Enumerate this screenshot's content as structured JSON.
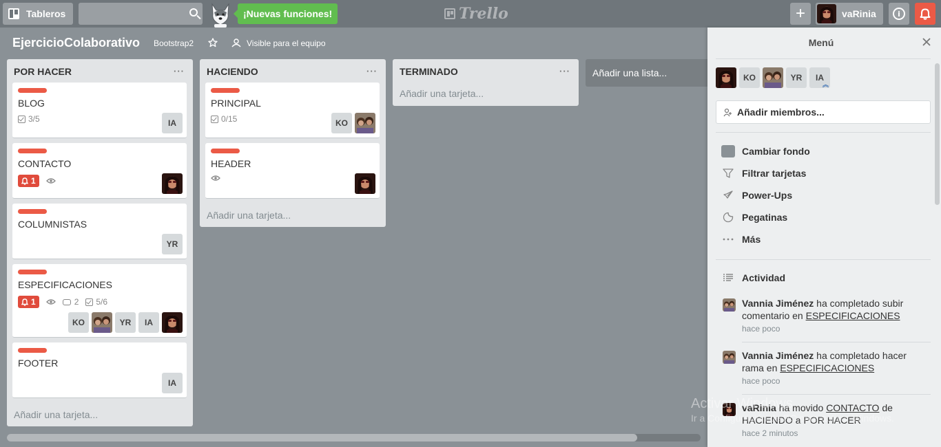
{
  "header": {
    "boards_label": "Tableros",
    "search_placeholder": "",
    "new_features": "¡Nuevas funciones!",
    "logo_text": "Trello",
    "add_label": "+",
    "user_name": "vaRinia"
  },
  "board": {
    "title": "EjercicioColaborativo",
    "team": "Bootstrap2",
    "visibility": "Visible para el equipo"
  },
  "lists": [
    {
      "title": "POR HACER",
      "menu": "···",
      "add_card": "Añadir una tarjeta...",
      "cards": [
        {
          "title": "BLOG",
          "checklist": "3/5",
          "members": [
            "IA"
          ]
        },
        {
          "title": "CONTACTO",
          "due": "1",
          "members": [
            "photo-varinia"
          ]
        },
        {
          "title": "COLUMNISTAS",
          "members": [
            "YR"
          ]
        },
        {
          "title": "ESPECIFICACIONES",
          "due": "1",
          "comments": "2",
          "checklist": "5/6",
          "members": [
            "KO",
            "photo-vannia",
            "YR",
            "IA",
            "photo-varinia"
          ]
        },
        {
          "title": "FOOTER",
          "members": [
            "IA"
          ]
        }
      ]
    },
    {
      "title": "HACIENDO",
      "menu": "···",
      "add_card": "Añadir una tarjeta...",
      "cards": [
        {
          "title": "PRINCIPAL",
          "checklist": "0/15",
          "members": [
            "KO",
            "photo-vannia"
          ]
        },
        {
          "title": "HEADER",
          "members": [
            "photo-varinia"
          ]
        }
      ]
    },
    {
      "title": "TERMINADO",
      "menu": "···",
      "add_card": "Añadir una tarjeta...",
      "cards": []
    }
  ],
  "add_list": "Añadir una lista...",
  "sidebar": {
    "title": "Menú",
    "members": [
      "photo-varinia",
      "KO",
      "photo-vannia",
      "YR",
      "IA"
    ],
    "add_members": "Añadir miembros...",
    "menu": [
      {
        "label": "Cambiar fondo",
        "icon": "background-swatch-icon"
      },
      {
        "label": "Filtrar tarjetas",
        "icon": "filter-icon"
      },
      {
        "label": "Power-Ups",
        "icon": "rocket-icon"
      },
      {
        "label": "Pegatinas",
        "icon": "sticker-icon"
      },
      {
        "label": "Más",
        "icon": "more-icon"
      }
    ],
    "activity_title": "Actividad",
    "activity": [
      {
        "user": "Vannia Jiménez",
        "text": " ha completado subir comentario en ",
        "link": "ESPECIFICACIONES",
        "tail": "",
        "time": "hace poco"
      },
      {
        "user": "Vannia Jiménez",
        "text": " ha completado hacer rama en ",
        "link": "ESPECIFICACIONES",
        "tail": "",
        "time": "hace poco"
      },
      {
        "user": "vaRinia",
        "text": " ha movido ",
        "link": "CONTACTO",
        "tail": " de HACIENDO a POR HACER",
        "time": "hace 2 minutos"
      }
    ]
  },
  "watermark": {
    "line1": "Activar Windows",
    "line2": "Ir a Configuración de PC para activar Windows."
  },
  "colors": {
    "label_red": "#eb5a46",
    "new_features_green": "#61bd4f",
    "board_bg": "#8a9196",
    "notification_red": "#eb5a46"
  }
}
